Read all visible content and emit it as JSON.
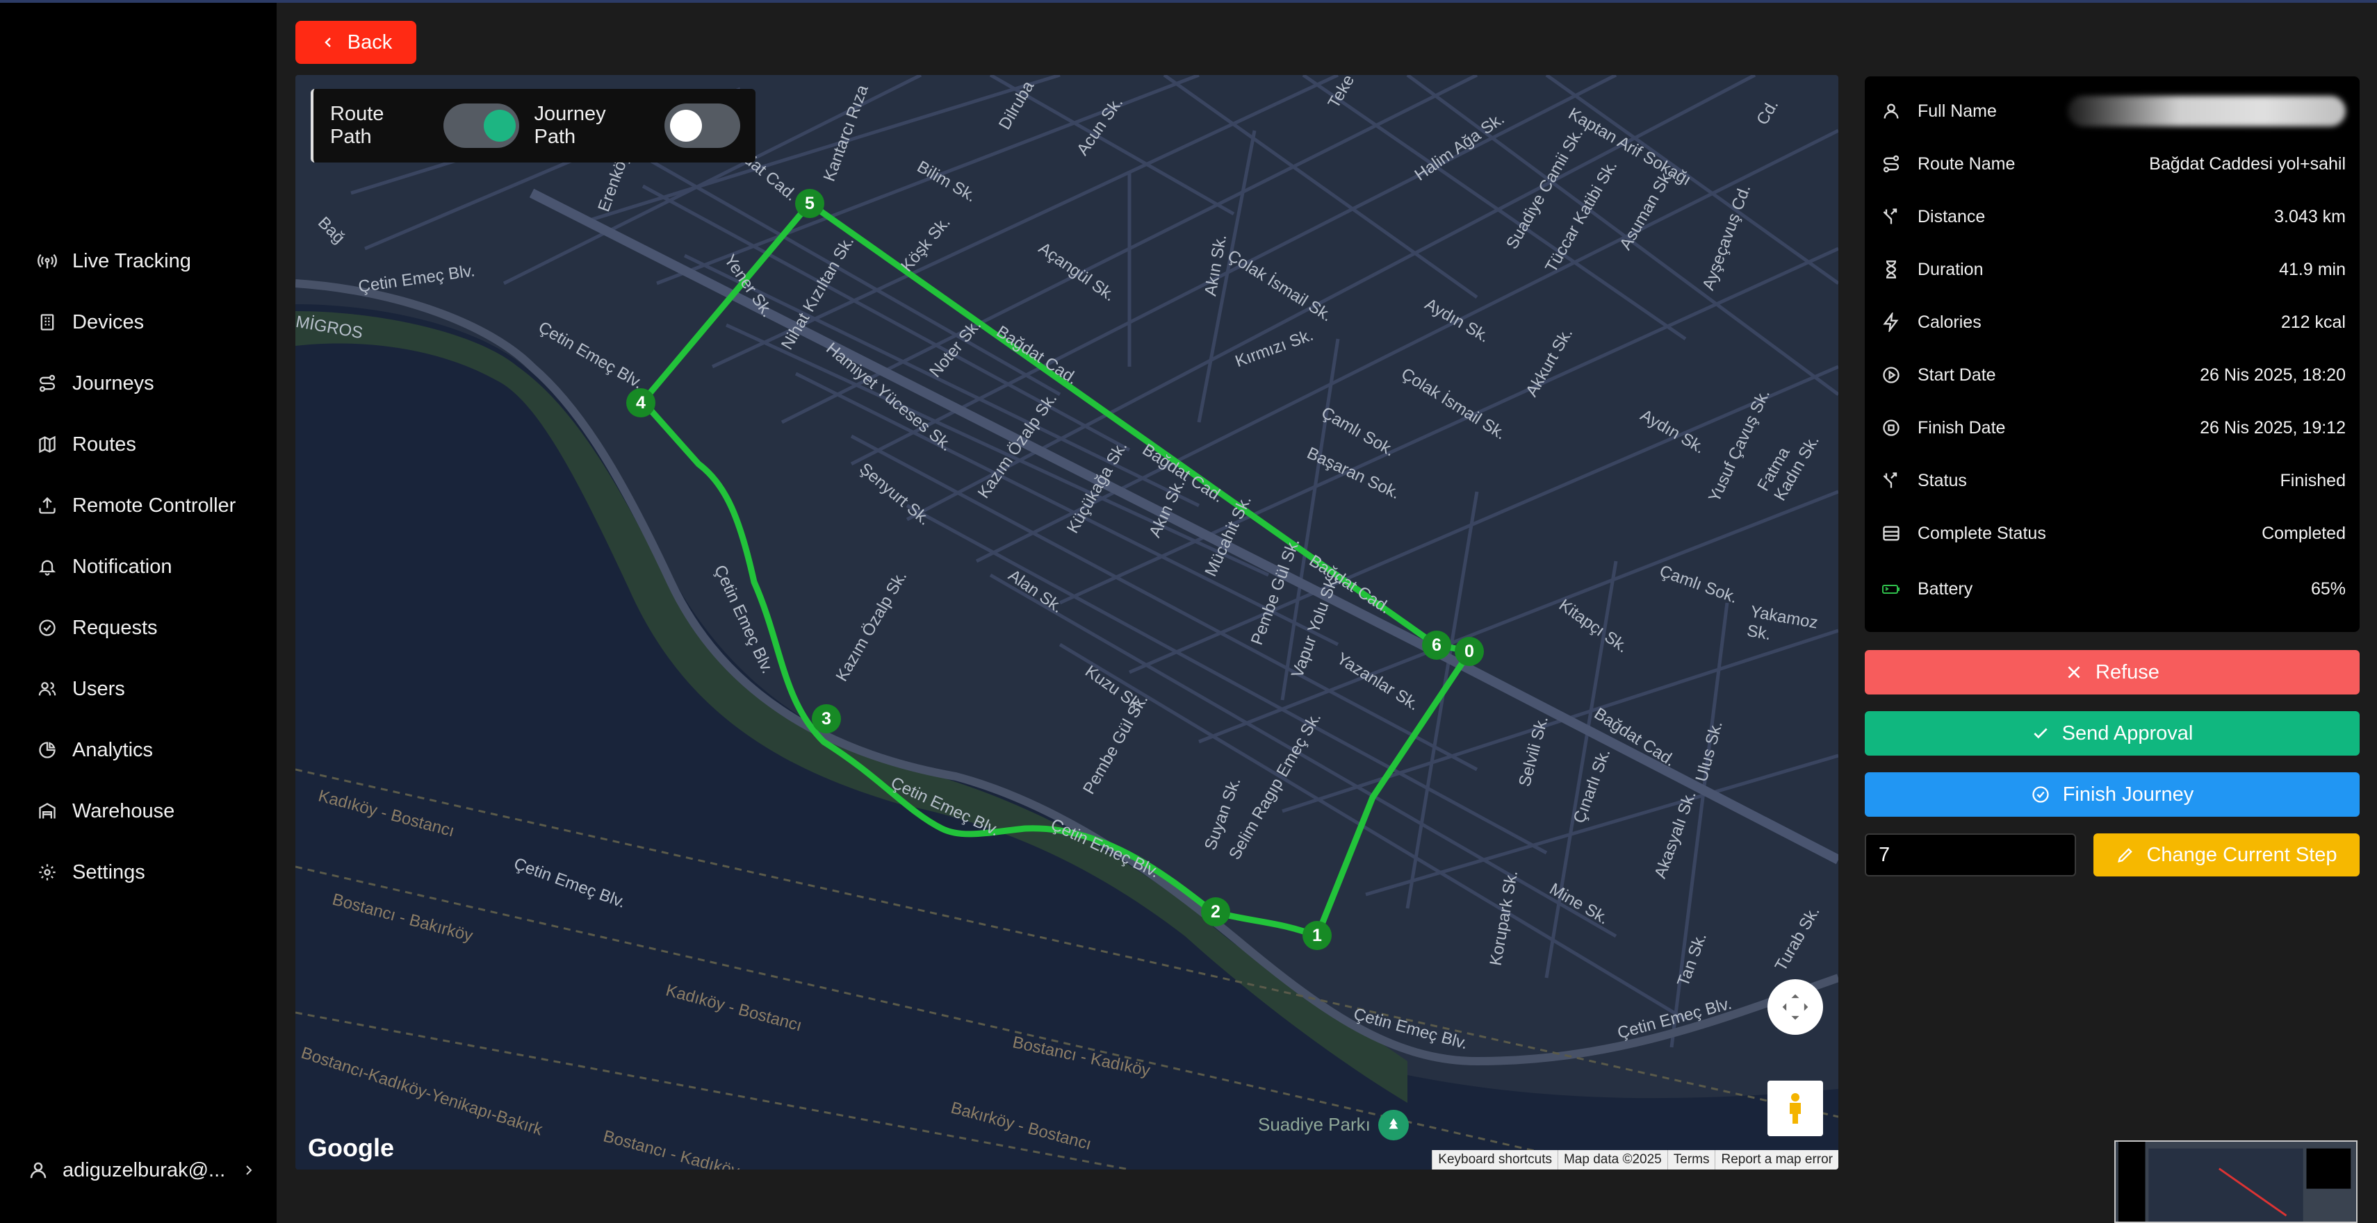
{
  "colors": {
    "accent_red": "#ff2a14",
    "refuse": "#f75c5c",
    "approve": "#10b77f",
    "finish": "#2196f3",
    "step": "#f6b800",
    "route": "#22c33a",
    "toggle_on": "#1db582"
  },
  "sidebar": {
    "items": [
      {
        "label": "Live Tracking",
        "icon": "broadcast-icon"
      },
      {
        "label": "Devices",
        "icon": "building-icon"
      },
      {
        "label": "Journeys",
        "icon": "route-icon"
      },
      {
        "label": "Routes",
        "icon": "map-icon"
      },
      {
        "label": "Remote Controller",
        "icon": "upload-icon"
      },
      {
        "label": "Notification",
        "icon": "bell-icon"
      },
      {
        "label": "Requests",
        "icon": "check-circle-icon"
      },
      {
        "label": "Users",
        "icon": "users-icon"
      },
      {
        "label": "Analytics",
        "icon": "pie-chart-icon"
      },
      {
        "label": "Warehouse",
        "icon": "warehouse-icon"
      },
      {
        "label": "Settings",
        "icon": "gear-icon"
      }
    ],
    "user": "adiguzelburak@..."
  },
  "header": {
    "back_label": "Back"
  },
  "map": {
    "toggles": {
      "route_label": "Route Path",
      "route_on": true,
      "journey_label": "Journey Path",
      "journey_on": false
    },
    "markers": [
      "0",
      "1",
      "2",
      "3",
      "4",
      "5",
      "6"
    ],
    "street_labels": [
      "Bağdat Cad.",
      "Bağdat Cad.",
      "Bağdat Cad.",
      "Bağdat Cad.",
      "Bağdat Cad.",
      "Çetin Emeç Blv.",
      "Çetin Emeç Blv.",
      "Çetin Emeç Blv.",
      "Çetin Emeç Blv.",
      "Çetin Emeç Blv.",
      "Çetin Emeç Blv.",
      "Çetin Emeç Blv.",
      "Çetin Emeç Blv.",
      "Kantarcı Rıza",
      "Bilim Sk.",
      "Acun Sk.",
      "Halim Ağa Sk.",
      "Kaptan Arif Sokağı",
      "Suadiye Camii Sk.",
      "Tüccar Katibi Sk.",
      "Asuman Sk.",
      "Ayşeçavuş Cd.",
      "Köşk Sk.",
      "Açangül Sk.",
      "Çolak İsmail Sk.",
      "Çolak İsmail Sk.",
      "Kırmızı Sk.",
      "Aydın Sk.",
      "Akkurt Sk.",
      "Nihat Kızıltan Sk.",
      "Hamiyet Yüceses Sk.",
      "Noter Sk.",
      "Çamlı Sok.",
      "Aydın Sk.",
      "Yusuf Çavuş Sk.",
      "Fatma Kadın Sk.",
      "Başaran Sok.",
      "Şenyurt Sk.",
      "Kazım Özalp Sk.",
      "Küçükağa Sk.",
      "Akın Sk.",
      "Mücahit Sk.",
      "Pembe Gül Sk.",
      "Vapur Yolu Sk.",
      "Çamlı Sok.",
      "Yakamoz Sk.",
      "Kitapçı Sk.",
      "Alan Sk.",
      "Kazım Özalp Sk.",
      "Kuzu Sk.",
      "Yazanlar Sk.",
      "Selvili Sk.",
      "Çınarlı Sk.",
      "Ulus Sk.",
      "Akasyalı Sk.",
      "Pembe Gül Sk.",
      "Suyan Sk.",
      "Selim Ragıp Emeç Sk.",
      "Korupark Sk.",
      "Mine Sk.",
      "Tan Sk.",
      "Turab Sk.",
      "Kadıköy - Bostancı",
      "Bostancı - Bakırköy",
      "Kadıköy - Bostancı",
      "Bostancı - Kadıköy",
      "Bakırköy - Bostancı",
      "Bostancı-Kadıköy-Yenikapı-Bakırk",
      "Bostancı - Kadıköy",
      "Suadiye Parkı",
      "Erenköy Cd.",
      "Yener Sk.",
      "Dilruba",
      "Teke",
      "Bağ",
      "Cd.",
      "MİGROS",
      "Akın Sk."
    ],
    "google_label": "Google",
    "attribution": [
      "Keyboard shortcuts",
      "Map data ©2025",
      "Terms",
      "Report a map error"
    ]
  },
  "info": {
    "rows": [
      {
        "key": "Full Name",
        "value": "",
        "icon": "user-icon"
      },
      {
        "key": "Route Name",
        "value": "Bağdat Caddesi yol+sahil",
        "icon": "route-icon"
      },
      {
        "key": "Distance",
        "value": "3.043 km",
        "icon": "split-icon"
      },
      {
        "key": "Duration",
        "value": "41.9 min",
        "icon": "hourglass-icon"
      },
      {
        "key": "Calories",
        "value": "212 kcal",
        "icon": "lightning-icon"
      },
      {
        "key": "Start Date",
        "value": "26 Nis 2025, 18:20",
        "icon": "play-circle-icon"
      },
      {
        "key": "Finish Date",
        "value": "26 Nis 2025, 19:12",
        "icon": "stop-circle-icon"
      },
      {
        "key": "Status",
        "value": "Finished",
        "icon": "split-icon"
      },
      {
        "key": "Complete Status",
        "value": "Completed",
        "icon": "table-icon"
      },
      {
        "key": "Battery",
        "value": "65%",
        "icon": "battery-icon"
      }
    ]
  },
  "actions": {
    "refuse": "Refuse",
    "approve": "Send Approval",
    "finish": "Finish Journey",
    "step_value": "7",
    "change_step": "Change Current Step"
  }
}
